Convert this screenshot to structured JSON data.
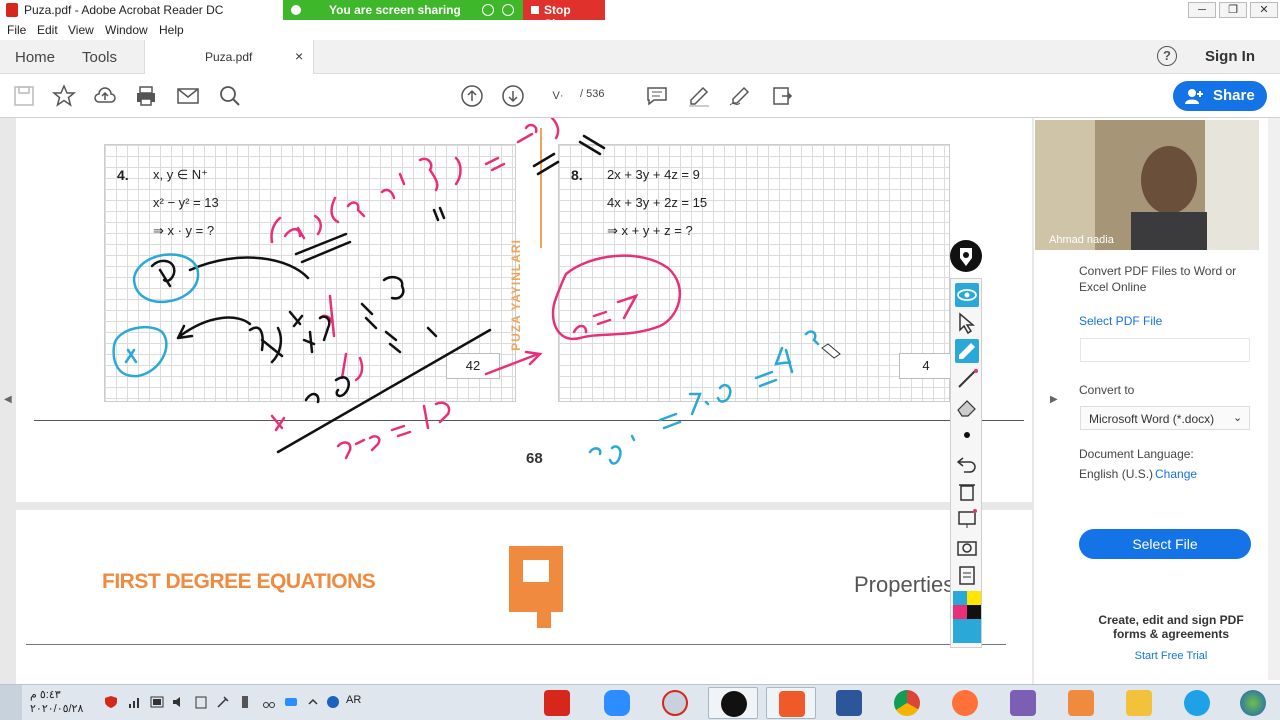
{
  "window": {
    "title": "Puza.pdf - Adobe Acrobat Reader DC",
    "controls": [
      "─",
      "❐",
      "✕"
    ]
  },
  "screen_share": {
    "status": "You are screen sharing",
    "stop_label": "Stop Share"
  },
  "menu": [
    "File",
    "Edit",
    "View",
    "Window",
    "Help"
  ],
  "tabs": {
    "home": "Home",
    "tools": "Tools",
    "document": "Puza.pdf",
    "close": "×",
    "help": "?",
    "sign_in": "Sign In"
  },
  "toolbar": {
    "page_current": "V·",
    "page_total": "/ 536",
    "share_label": "Share"
  },
  "document": {
    "problem4": {
      "number": "4.",
      "line1": "x, y ∈ N⁺",
      "line2": "x² − y² = 13",
      "line3": "⇒ x · y = ?",
      "answer": "42"
    },
    "problem8": {
      "number": "8.",
      "line1": "2x + 3y + 4z = 9",
      "line2": "4x + 3y + 2z = 15",
      "line3": "⇒ x + y + z = ?",
      "answer": "4"
    },
    "publisher": "PUZA YAYINLARI",
    "page_number": "68",
    "chapter_title": "FIRST DEGREE EQUATIONS",
    "section_title": "Properties"
  },
  "webcam": {
    "participant": "Ahmad nadia"
  },
  "right_panel": {
    "heading": "Convert PDF Files to Word or Excel Online",
    "select_pdf_link": "Select PDF File",
    "convert_to_label": "Convert to",
    "convert_to_value": "Microsoft Word (*.docx)",
    "language_label": "Document Language:",
    "language_value": "English (U.S.)",
    "change_link": "Change",
    "select_file_button": "Select File",
    "promo": "Create, edit and sign PDF forms & agreements",
    "trial_link": "Start Free Trial"
  },
  "taskbar": {
    "time": "٥:٤٣ م",
    "date": "٢٠٢٠/٠٥/٢٨",
    "language": "AR",
    "apps": [
      "acrobat",
      "zoom",
      "snipping-tool",
      "annotation-app",
      "screen-recorder",
      "word",
      "chrome",
      "firefox",
      "visual-studio",
      "media-player",
      "file-explorer",
      "internet-explorer",
      "start-button"
    ]
  },
  "colors": {
    "acrobat_blue": "#1473e6",
    "share_green": "#3fb72b",
    "stop_red": "#e0312d",
    "ink_pink": "#e8307a",
    "ink_blue": "#2aa8d8",
    "ink_black": "#111111",
    "chapter_orange": "#f08a3e"
  }
}
